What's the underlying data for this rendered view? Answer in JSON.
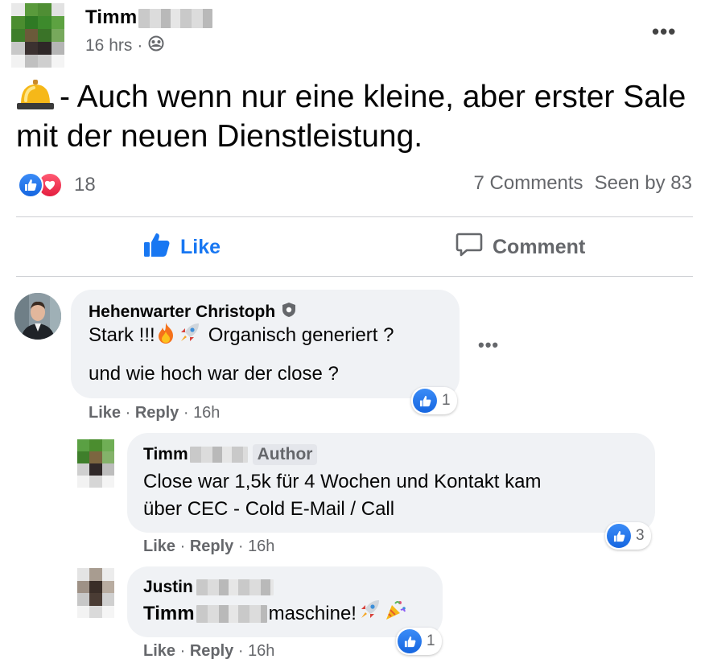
{
  "post": {
    "author_first": "Timm",
    "time": "16 hrs",
    "privacy_icon": "friends-icon",
    "more_icon": "more-icon",
    "text": "- Auch wenn nur eine kleine, aber erster Sale mit der neuen Dienstleistung.",
    "emoji": "bell-icon",
    "reaction_count": "18",
    "comments_label": "7 Comments",
    "seen_label": "Seen by 83",
    "like_label": "Like",
    "comment_label": "Comment"
  },
  "comments": [
    {
      "name": "Hehenwarter Christoph",
      "line1": "Stark !!!",
      "line1_after": "Organisch generiert ?",
      "line2": "und wie hoch war der close ?",
      "like": "Like",
      "reply": "Reply",
      "time": "16h",
      "reactions": "1"
    },
    {
      "name": "Timm",
      "badge": "Author",
      "text_line1": "Close war 1,5k für 4 Wochen und Kontakt kam",
      "text_line2": "über CEC - Cold E-Mail / Call",
      "like": "Like",
      "reply": "Reply",
      "time": "16h",
      "reactions": "3"
    },
    {
      "name": "Justin",
      "mention": "Timm",
      "text_after": "maschine!",
      "like": "Like",
      "reply": "Reply",
      "time": "16h",
      "reactions": "1"
    }
  ],
  "colors": {
    "accent": "#1877f2",
    "muted": "#65676b",
    "bubble": "#f0f2f5",
    "divider": "#ced0d4"
  }
}
